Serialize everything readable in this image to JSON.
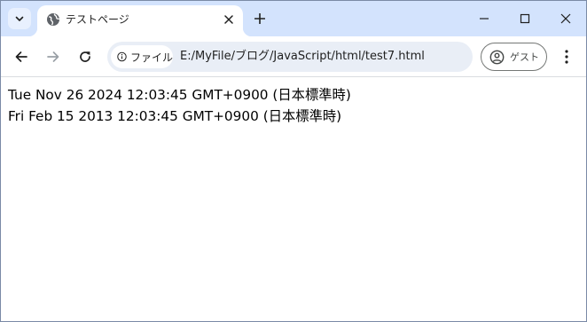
{
  "tab": {
    "title": "テストページ"
  },
  "toolbar": {
    "site_chip_label": "ファイル",
    "url": "E:/MyFile/ブログ/JavaScript/html/test7.html",
    "profile_label": "ゲスト"
  },
  "page": {
    "lines": [
      "Tue Nov 26 2024 12:03:45 GMT+0900 (日本標準時)",
      "Fri Feb 15 2013 12:03:45 GMT+0900 (日本標準時)"
    ]
  },
  "icons": {
    "tab_search": "chevron-down-icon",
    "favicon": "globe-icon",
    "tab_close": "close-icon",
    "new_tab": "plus-icon",
    "minimize": "minimize-icon",
    "maximize": "maximize-icon",
    "close_window": "close-icon",
    "back": "arrow-left-icon",
    "forward": "arrow-right-icon",
    "reload": "reload-icon",
    "info": "info-icon",
    "profile": "person-icon",
    "menu": "kebab-menu-icon"
  },
  "colors": {
    "tabstrip": "#d3e3fd",
    "omnibox": "#e9eef6",
    "icon": "#1f1f1f",
    "disabled_icon": "#9aa0a6"
  }
}
